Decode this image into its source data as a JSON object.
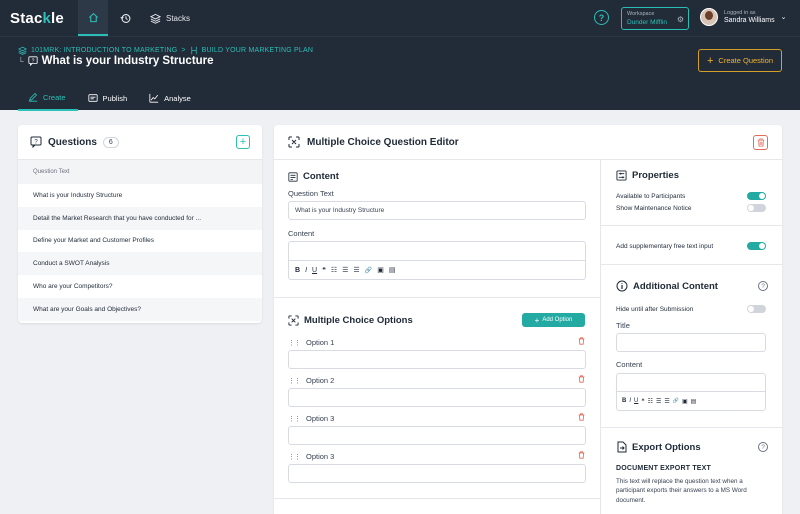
{
  "app": {
    "logo_main": "Stac",
    "logo_accent": "k",
    "logo_end": "le"
  },
  "topbar": {
    "stacks_label": "Stacks",
    "help_label": "?",
    "workspace_label": "Workspace",
    "workspace_value": "Dunder Mifflin",
    "user_label": "Logged in as",
    "user_name": "Sandra Williams"
  },
  "breadcrumb": {
    "course": "101MRK: INTRODUCTION TO MARKETING",
    "separator": ">",
    "stack": "BUILD YOUR MARKETING PLAN"
  },
  "page_title": "What is your Industry Structure",
  "create_question_label": "Create Question",
  "tabs": [
    {
      "label": "Create",
      "active": true
    },
    {
      "label": "Publish",
      "active": false
    },
    {
      "label": "Analyse",
      "active": false
    }
  ],
  "questions_panel": {
    "title": "Questions",
    "count": "6",
    "column_header": "Question Text",
    "items": [
      "What is your Industry Structure",
      "Detail the Market Research that you have conducted for ...",
      "Define your Market and Customer Profiles",
      "Conduct a SWOT Analysis",
      "Who are your Competitors?",
      "What are your Goals and Objectives?"
    ]
  },
  "editor": {
    "title": "Multiple Choice Question Editor",
    "content_title": "Content",
    "question_text_label": "Question Text",
    "question_text_value": "What is your Industry Structure",
    "content_label": "Content",
    "toolbar": [
      "B",
      "I",
      "U",
      "❝",
      "☷",
      "☰",
      "☰",
      "🔗",
      "▣",
      "▤"
    ],
    "options_title": "Multiple Choice Options",
    "add_option_label": "Add Option",
    "options": [
      "Option 1",
      "Option 2",
      "Option 3",
      "Option 3"
    ]
  },
  "properties": {
    "title": "Properties",
    "available_label": "Available to Participants",
    "available_on": true,
    "maintenance_label": "Show Maintenance Notice",
    "maintenance_on": false,
    "supplementary_label": "Add supplementary free text input",
    "supplementary_on": true
  },
  "additional": {
    "title": "Additional Content",
    "hide_label": "Hide until after Submission",
    "hide_on": false,
    "title_label": "Title",
    "content_label": "Content"
  },
  "export": {
    "title": "Export Options",
    "subtitle": "DOCUMENT EXPORT TEXT",
    "description": "This text will replace the question text when a participant exports their answers to a MS Word document."
  },
  "colors": {
    "accent": "#2bbfb7",
    "topbar": "#222b38",
    "warning": "#f2b52f",
    "danger": "#e06b5a"
  }
}
